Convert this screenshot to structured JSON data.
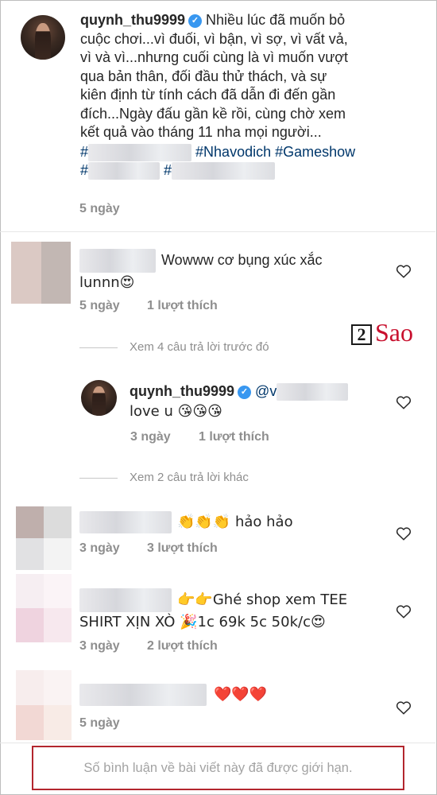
{
  "post": {
    "username": "quynh_thu9999",
    "caption_lines": [
      "Nhiều lúc đã muốn bỏ",
      "cuộc chơi...vì đuối, vì bận, vì sợ, vì vất vả,",
      "vì và vì...nhưng cuối cùng là vì muốn vượt",
      "qua bản thân, đối đầu thử thách, và sự",
      "kiên định từ tính cách đã dẫn đi đến gần",
      "đích...Ngày đấu gần kề rồi, cùng chờ xem",
      "kết quả vào tháng 11 nha mọi người..."
    ],
    "hashtag_line1_prefix": "#",
    "hashtag_1": "#Nhavodich",
    "hashtag_2": "#Gameshow",
    "hashtag_line2_a": "#",
    "hashtag_line2_b": "#",
    "time": "5 ngày"
  },
  "comments": [
    {
      "text_line1": "Wowww cơ bụng xúc xắc",
      "text_line2": "lunnn😍",
      "time": "5 ngày",
      "likes": "1 lượt thích"
    },
    {
      "text": "👏👏👏 hảo hảo",
      "time": "3 ngày",
      "likes": "3 lượt thích"
    },
    {
      "text_line1": "👉👉Ghé shop xem TEE",
      "text_line2": "SHIRT XỊN XÒ 🎉1c 69k 5c 50k/c😍",
      "time": "3 ngày",
      "likes": "2 lượt thích"
    },
    {
      "text": "❤️❤️❤️",
      "time": "5 ngày"
    }
  ],
  "reply_thread": {
    "view_previous": "Xem 4 câu trả lời trước đó",
    "reply": {
      "username": "quynh_thu9999",
      "mention": "@v",
      "text": "love u 😘😘😘",
      "time": "3 ngày",
      "likes": "1 lượt thích"
    },
    "view_more": "Xem 2 câu trả lời khác"
  },
  "watermark": {
    "digit": "2",
    "word": "Sao"
  },
  "limit_notice": "Số bình luận về bài viết này đã được giới hạn.",
  "colors": {
    "link": "#00376b",
    "verified": "#3897f0",
    "muted": "#8e8e8e",
    "notice_border": "#b3262e",
    "watermark_red": "#c8102e"
  },
  "icons": [
    "verified-badge-icon",
    "heart-outline-icon"
  ]
}
